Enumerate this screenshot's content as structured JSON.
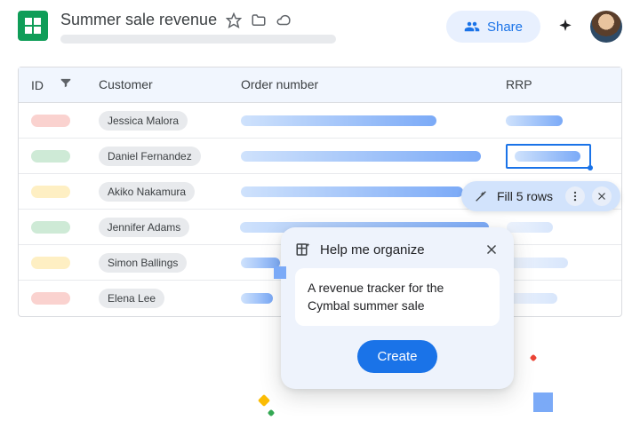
{
  "header": {
    "doc_title": "Summer sale revenue",
    "share_label": "Share"
  },
  "table": {
    "columns": {
      "id": "ID",
      "customer": "Customer",
      "order": "Order number",
      "rrp": "RRP"
    },
    "rows": [
      {
        "id_color": "red",
        "customer": "Jessica Malora",
        "order_w": 220,
        "rrp_w": 64,
        "rrp_light": false
      },
      {
        "id_color": "green",
        "customer": "Daniel Fernandez",
        "order_w": 270,
        "rrp_w": 74,
        "rrp_light": false,
        "rrp_selected": true
      },
      {
        "id_color": "yellow",
        "customer": "Akiko Nakamura",
        "order_w": 250,
        "rrp_w": 60,
        "rrp_light": true
      },
      {
        "id_color": "green",
        "customer": "Jennifer Adams",
        "order_w": 280,
        "rrp_w": 52,
        "rrp_light": true
      },
      {
        "id_color": "yellow",
        "customer": "Simon Ballings",
        "order_w": 44,
        "rrp_w": 70,
        "rrp_light": true
      },
      {
        "id_color": "red",
        "customer": "Elena Lee",
        "order_w": 36,
        "rrp_w": 58,
        "rrp_light": true
      }
    ]
  },
  "fill_chip": {
    "label": "Fill 5 rows"
  },
  "panel": {
    "title": "Help me organize",
    "prompt": "A revenue tracker for the Cymbal summer sale",
    "button": "Create"
  }
}
